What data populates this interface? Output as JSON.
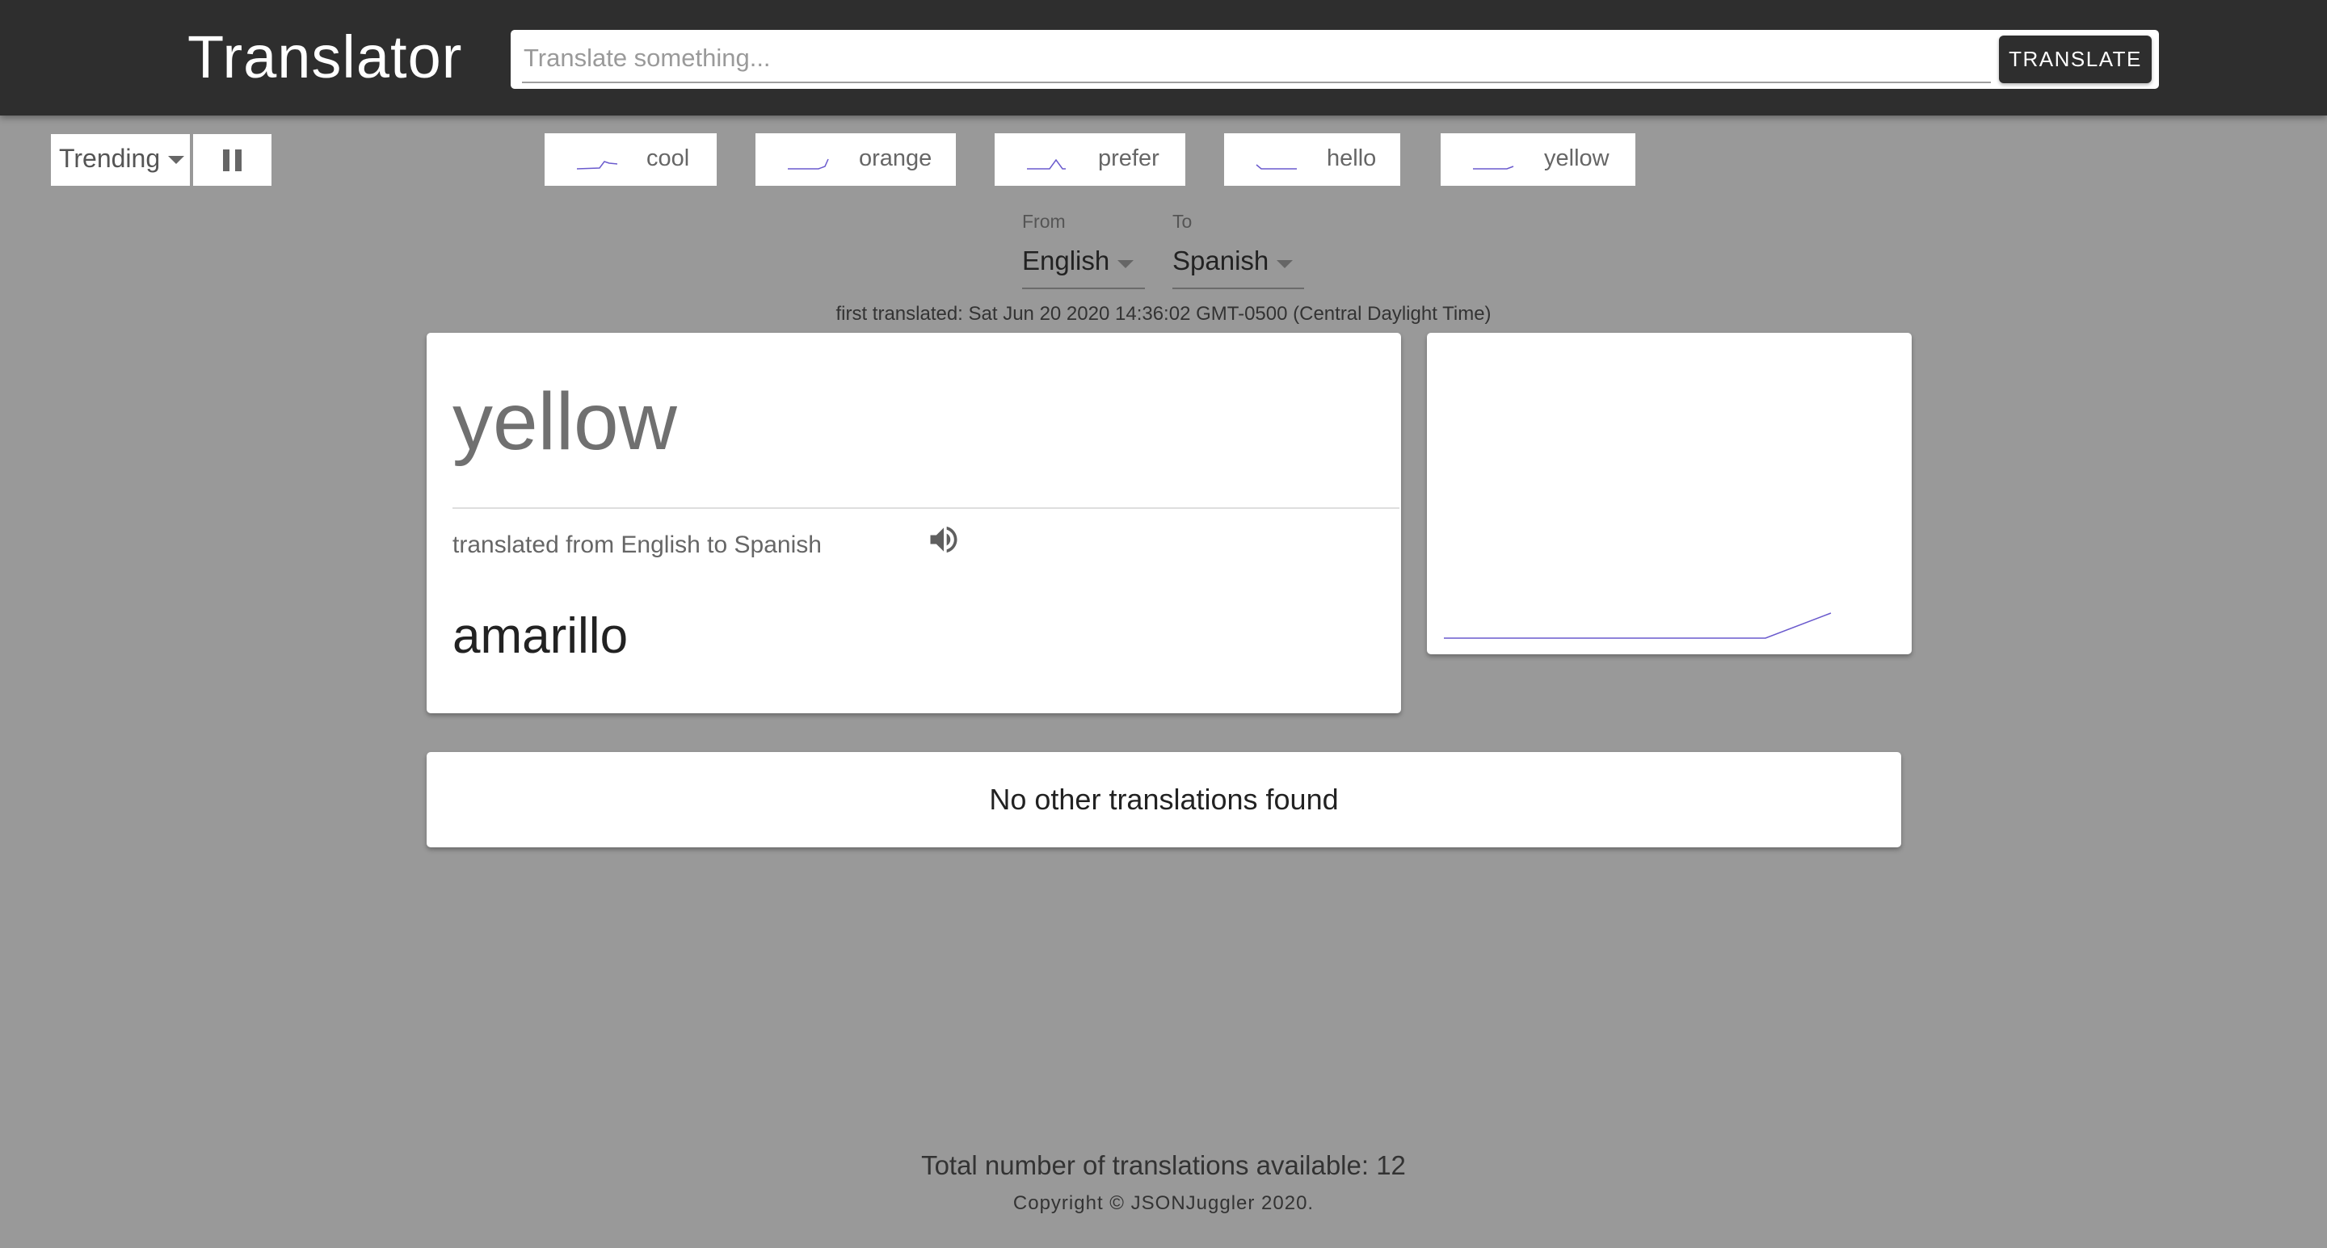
{
  "app": {
    "title": "Translator"
  },
  "search": {
    "placeholder": "Translate something...",
    "value": "",
    "button_label": "TRANSLATE"
  },
  "controls": {
    "mode_label": "Trending",
    "pause_icon": "pause-icon"
  },
  "trending": [
    {
      "word": "cool"
    },
    {
      "word": "orange"
    },
    {
      "word": "prefer"
    },
    {
      "word": "hello"
    },
    {
      "word": "yellow"
    }
  ],
  "languages": {
    "from_label": "From",
    "from_value": "English",
    "to_label": "To",
    "to_value": "Spanish"
  },
  "first_translated": "first translated: Sat Jun 20 2020 14:36:02 GMT-0500 (Central Daylight Time)",
  "result": {
    "source_word": "yellow",
    "direction_text": "translated from English to Spanish",
    "speaker_icon": "speaker-icon",
    "translation": "amarillo"
  },
  "other_translations": {
    "message": "No other translations found"
  },
  "footer": {
    "count_text": "Total number of translations available: 12",
    "copyright": "Copyright © JSONJuggler 2020."
  },
  "colors": {
    "appbar": "#2e2e2e",
    "background": "#999999",
    "sparkline": "#6a5acd"
  }
}
